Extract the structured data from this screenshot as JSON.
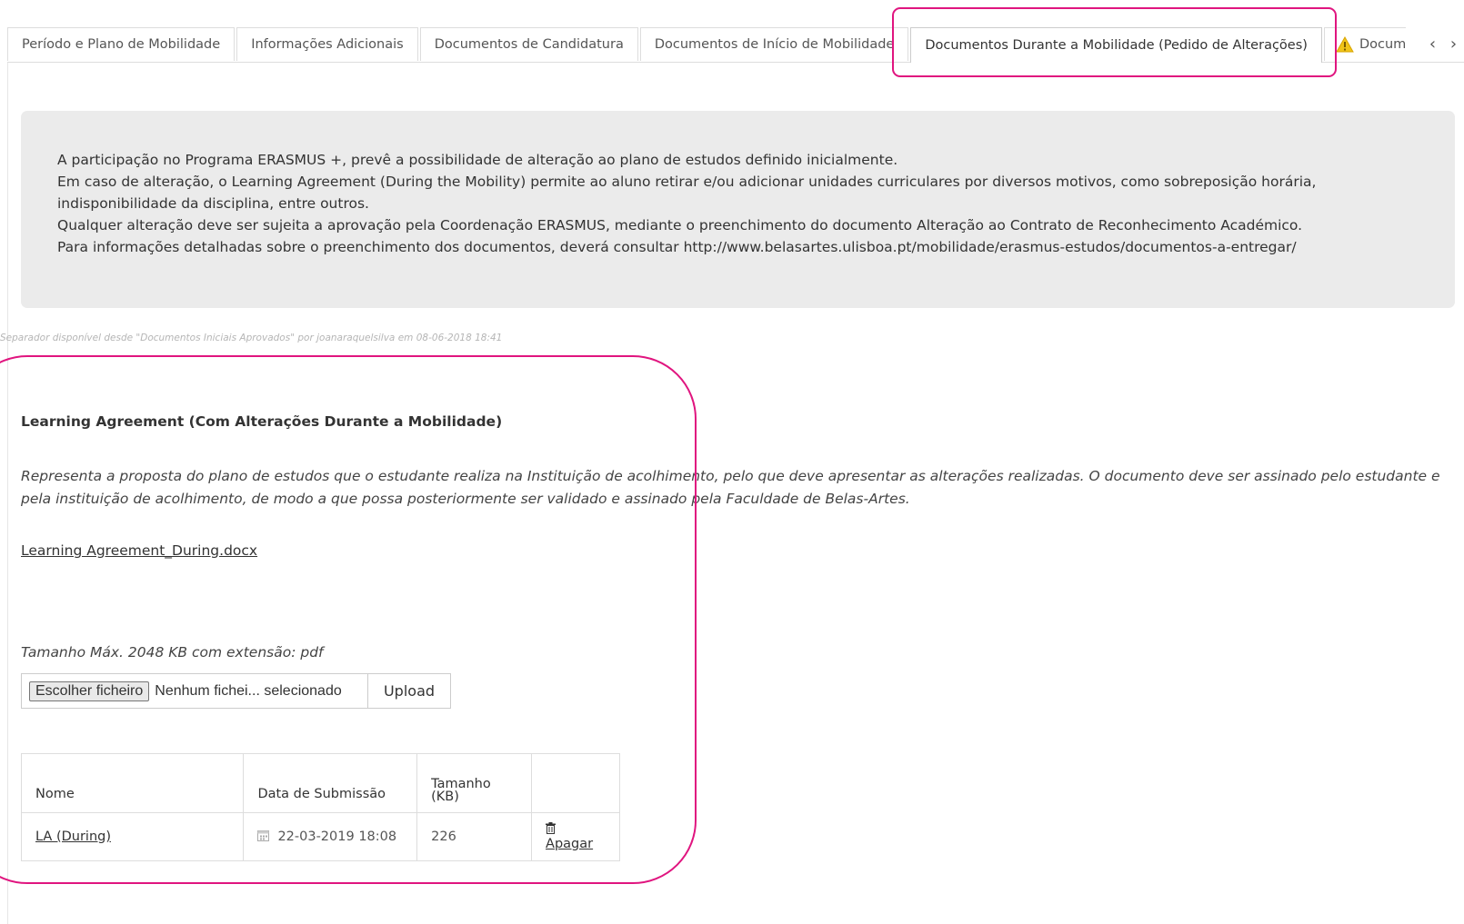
{
  "tabs": [
    {
      "label": "Período e Plano de Mobilidade"
    },
    {
      "label": "Informações Adicionais"
    },
    {
      "label": "Documentos de Candidatura"
    },
    {
      "label": "Documentos de Início de Mobilidade"
    },
    {
      "label": "Documentos Durante a Mobilidade (Pedido de Alterações)",
      "active": true
    },
    {
      "label": "Documentos Finais",
      "icon": "warning-icon"
    }
  ],
  "tab_nav": {
    "prev": "‹",
    "next": "›"
  },
  "info": {
    "line1": "A participação no Programa ERASMUS +, prevê a possibilidade de alteração ao plano de estudos definido inicialmente.",
    "line2": "Em caso de alteração, o Learning Agreement (During the Mobility) permite ao aluno retirar e/ou adicionar unidades curriculares por diversos motivos, como sobreposição horária, indisponibilidade da disciplina, entre outros.",
    "line3": "Qualquer alteração deve ser sujeita a aprovação pela Coordenação ERASMUS, mediante o preenchimento do documento Alteração ao Contrato de Reconhecimento Académico.",
    "line4": "Para informações detalhadas sobre o preenchimento dos documentos, deverá consultar http://www.belasartes.ulisboa.pt/mobilidade/erasmus-estudos/documentos-a-entregar/"
  },
  "availability_note": "Separador disponível desde \"Documentos Iniciais Aprovados\" por joanaraquelsilva em 08-06-2018 18:41",
  "document": {
    "title": "Learning Agreement (Com Alterações Durante a Mobilidade)",
    "description": "Representa a proposta do plano de estudos que o estudante realiza na Instituição de acolhimento, pelo que deve apresentar as alterações realizadas. O documento deve ser assinado pelo estudante e pela instituição de acolhimento, de modo a que possa posteriormente ser validado e assinado pela Faculdade de Belas-Artes.",
    "template_link": "Learning Agreement_During.docx",
    "max_size": "Tamanho Máx. 2048 KB com extensão: pdf"
  },
  "upload": {
    "choose_label": "Escolher ficheiro",
    "file_status": "Nenhum fichei... selecionado",
    "upload_label": "Upload"
  },
  "table": {
    "headers": {
      "name": "Nome",
      "date": "Data de Submissão",
      "size": "Tamanho (KB)",
      "actions": ""
    },
    "rows": [
      {
        "name": "LA (During)",
        "date": "22-03-2019 18:08",
        "size": "226",
        "action": "Apagar"
      }
    ]
  },
  "colors": {
    "highlight": "#e0157f",
    "info_bg": "#ebebeb",
    "warning": "#f0c419"
  }
}
